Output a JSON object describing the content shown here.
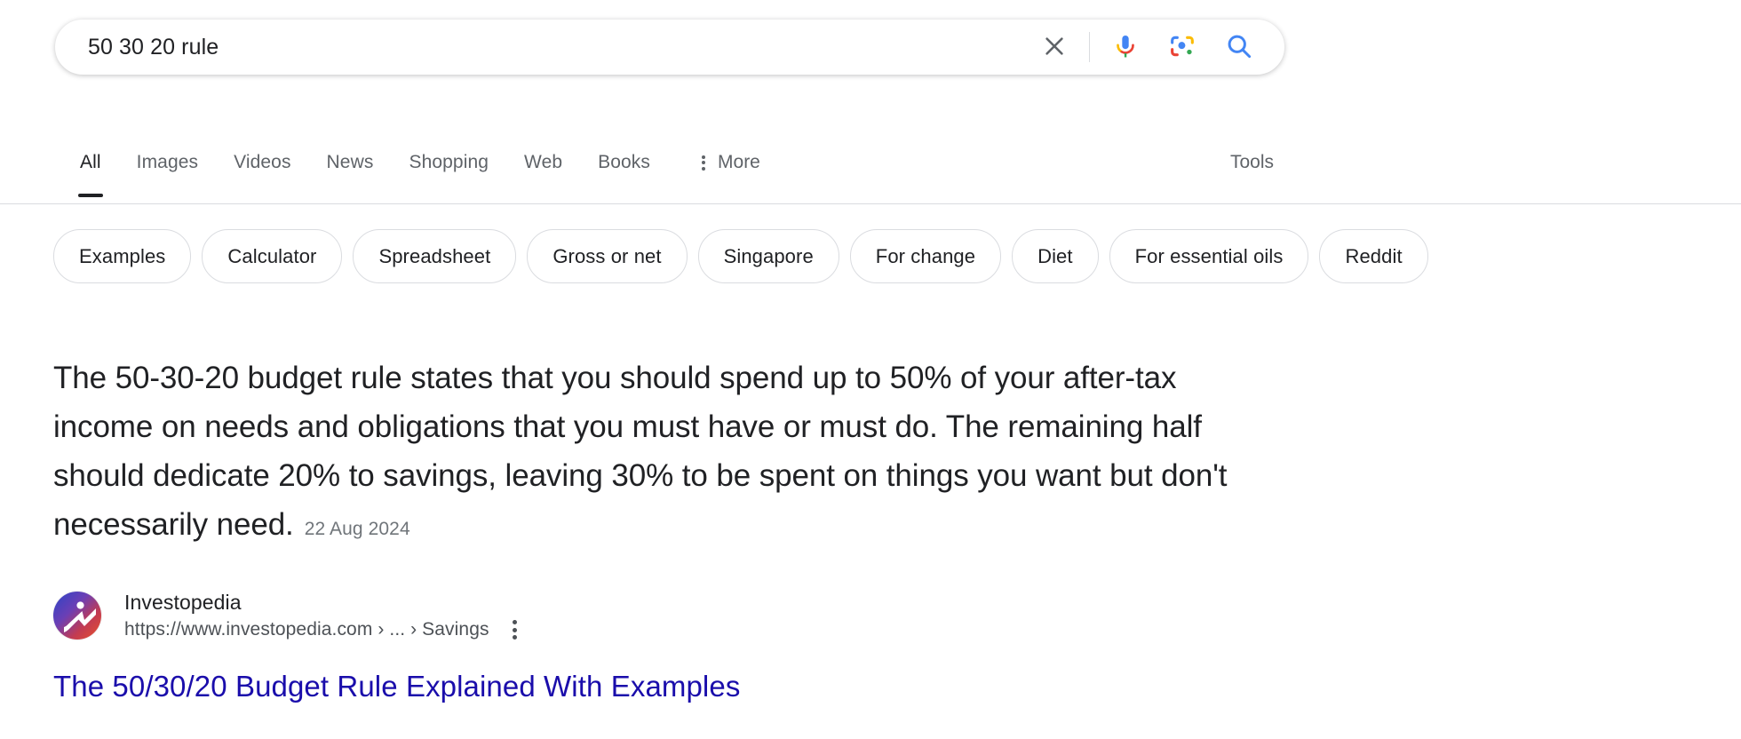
{
  "search": {
    "query": "50 30 20 rule",
    "placeholder": "Search",
    "clear_label": "Clear",
    "icons": {
      "clear": "close-icon",
      "mic": "microphone-icon",
      "lens": "google-lens-icon",
      "search": "search-icon"
    }
  },
  "nav": {
    "tabs": [
      {
        "label": "All",
        "active": true
      },
      {
        "label": "Images",
        "active": false
      },
      {
        "label": "Videos",
        "active": false
      },
      {
        "label": "News",
        "active": false
      },
      {
        "label": "Shopping",
        "active": false
      },
      {
        "label": "Web",
        "active": false
      },
      {
        "label": "Books",
        "active": false
      }
    ],
    "more_label": "More",
    "tools_label": "Tools"
  },
  "chips": [
    {
      "label": "Examples"
    },
    {
      "label": "Calculator"
    },
    {
      "label": "Spreadsheet"
    },
    {
      "label": "Gross or net"
    },
    {
      "label": "Singapore"
    },
    {
      "label": "For change"
    },
    {
      "label": "Diet"
    },
    {
      "label": "For essential oils"
    },
    {
      "label": "Reddit"
    }
  ],
  "featured_snippet": {
    "text": "The 50-30-20 budget rule states that you should spend up to 50% of your after-tax income on needs and obligations that you must have or must do. The remaining half should dedicate 20% to savings, leaving 30% to be spent on things you want but don't necessarily need.",
    "date": "22 Aug 2024"
  },
  "result": {
    "source_name": "Investopedia",
    "url": "https://www.investopedia.com › ... › Savings",
    "title": "The 50/30/20 Budget Rule Explained With Examples",
    "favicon_name": "investopedia-favicon",
    "menu_name": "result-options-menu"
  },
  "colors": {
    "link": "#1a0dab",
    "text": "#202124",
    "muted": "#70757a",
    "url": "#4d5156",
    "border": "#dadce0",
    "google_blue": "#4285f4",
    "google_red": "#ea4335",
    "google_yellow": "#fbbc05",
    "google_green": "#34a853"
  }
}
